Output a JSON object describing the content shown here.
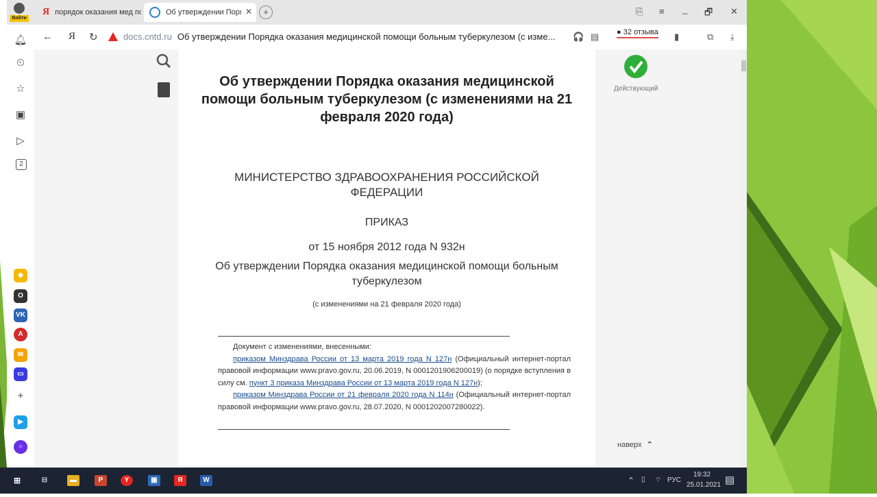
{
  "browser": {
    "profile_label": "Войти",
    "tabs": [
      {
        "label": "порядок оказания мед по"
      },
      {
        "label": "Об утверждении Поря."
      }
    ],
    "close_glyph": "✕",
    "newtab_glyph": "+",
    "window_controls": [
      "⎘",
      "≡",
      "_",
      "🗗",
      "✕"
    ],
    "nav": {
      "back": "←",
      "yandex": "Я",
      "reload": "↻"
    },
    "address": {
      "domain": "docs.cntd.ru",
      "title": "Об утверждении Порядка оказания медицинской помощи больным туберкулезом (с изме..."
    },
    "reviews": "32 отзыва",
    "colors": {
      "warning": "#e52620",
      "accent_green": "#2fae3a"
    }
  },
  "sidebar": {
    "icons": [
      "bell-icon",
      "history-icon",
      "star-icon",
      "collections-icon",
      "play-icon"
    ],
    "counter_badge": "2",
    "apps": [
      "market-icon",
      "alice-icon",
      "vk-icon",
      "opera-icon",
      "mail-icon",
      "messenger-icon",
      "add-icon",
      "zen-icon",
      "alice-ball-icon"
    ]
  },
  "document": {
    "title": "Об утверждении Порядка оказания медицинской помощи больным туберкулезом (с изменениями на 21 февраля 2020 года)",
    "ministry": "МИНИСТЕРСТВО ЗДРАВООХРАНЕНИЯ РОССИЙСКОЙ ФЕДЕРАЦИИ",
    "order_label": "ПРИКАЗ",
    "order_date": "от 15 ноября 2012 года N 932н",
    "order_title": "Об утверждении Порядка оказания медицинской помощи больным туберкулезом",
    "amend_note": "(с изменениями на 21 февраля 2020 года)",
    "changes": {
      "intro": "Документ с изменениями, внесенными:",
      "link1": "приказом Минздрава России от 13 марта 2019 года N 127н",
      "text1": " (Официальный интернет-портал правовой информации www.pravo.gov.ru, 20.06.2019, N 0001201906200019) (о порядке вступления в силу см. ",
      "link2": "пункт 3 приказа Минздрава России от 13 марта 2019 года N 127н",
      "text2": ");",
      "link3": "приказом Минздрава России от 21 февраля 2020 года N 114н",
      "text3": " (Официальный интернет-портал правовой информации www.pravo.gov.ru, 28.07.2020, N 0001202007280022)."
    },
    "status": "Действующий",
    "to_top": "наверх"
  },
  "taskbar": {
    "lang": "РУС",
    "time": "19:32",
    "date": "25.01.2021"
  }
}
